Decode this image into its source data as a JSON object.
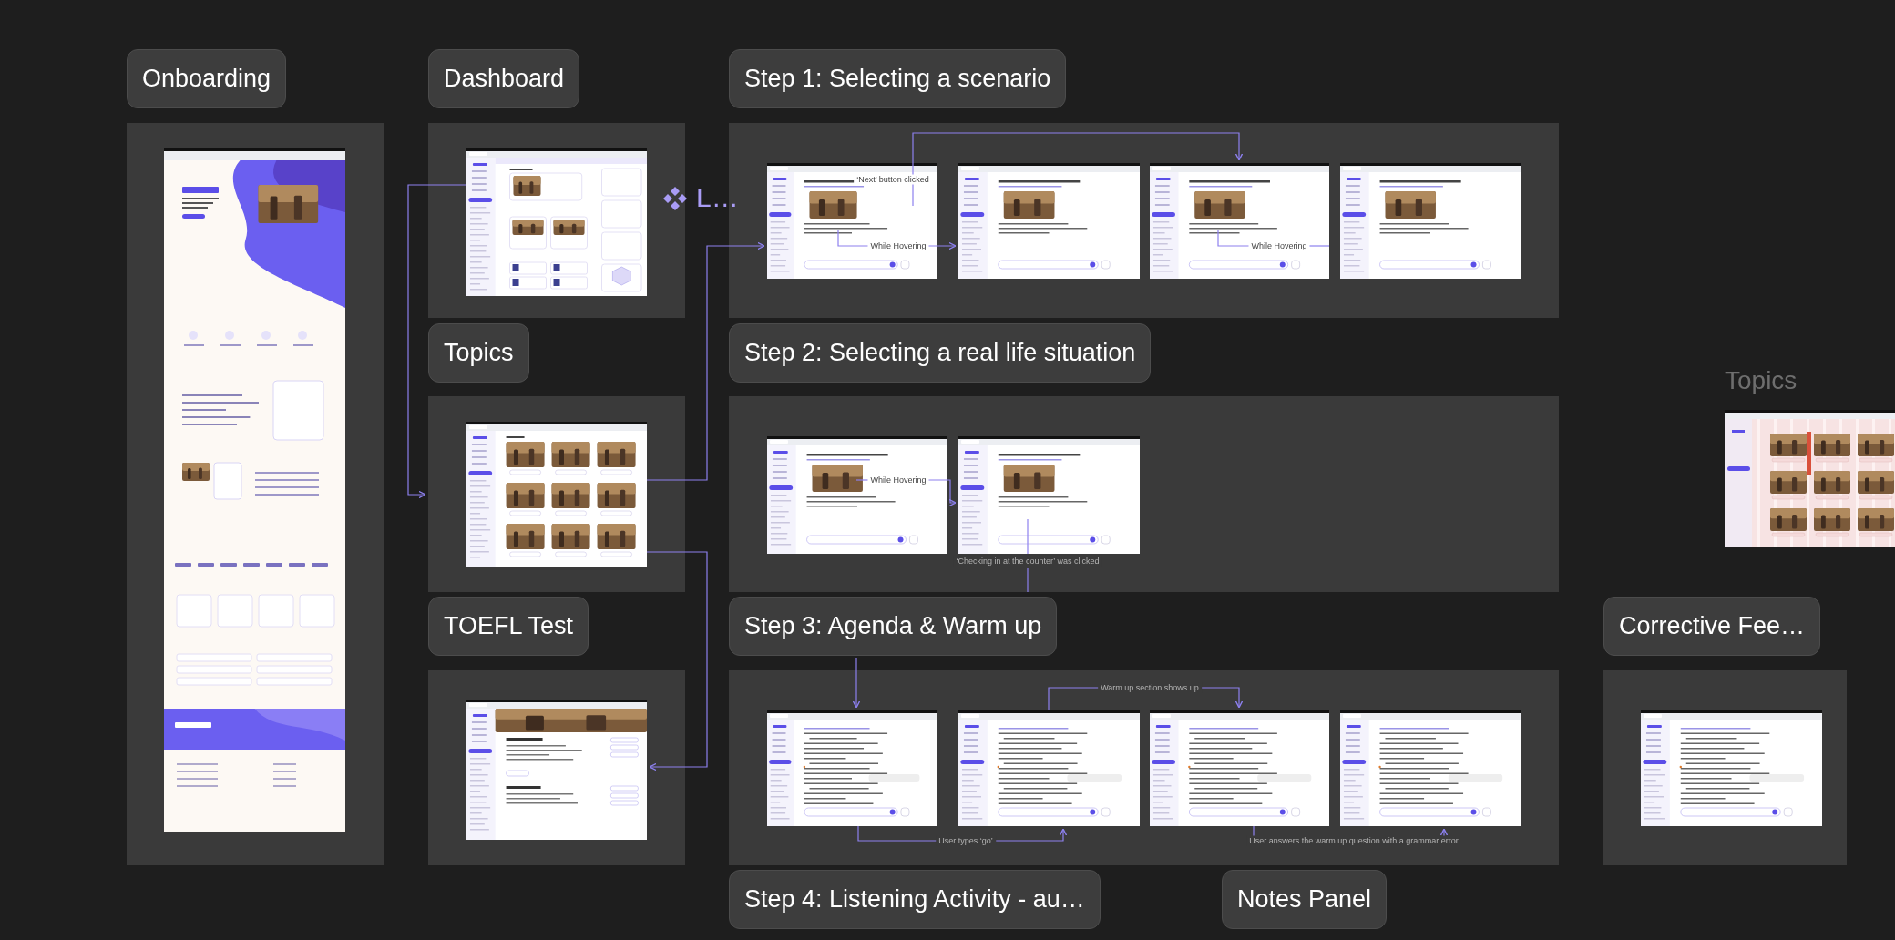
{
  "sections": [
    {
      "label": "Onboarding",
      "screens": [
        {
          "kind": "landing"
        }
      ]
    },
    {
      "label": "Dashboard",
      "screens": [
        {
          "kind": "dashboard"
        }
      ]
    },
    {
      "label": "Topics",
      "screens": [
        {
          "kind": "grid"
        }
      ]
    },
    {
      "label": "TOEFL Test",
      "screens": [
        {
          "kind": "toefl"
        }
      ]
    },
    {
      "label": "Step 1: Selecting a scenario",
      "screens": [
        {
          "kind": "chat-photo"
        },
        {
          "kind": "chat-photo"
        },
        {
          "kind": "chat-photo"
        },
        {
          "kind": "chat-photo"
        }
      ]
    },
    {
      "label": "Step 2: Selecting a real life situation",
      "screens": [
        {
          "kind": "chat-photo"
        },
        {
          "kind": "chat-photo"
        }
      ]
    },
    {
      "label": "Step 3: Agenda & Warm up",
      "screens": [
        {
          "kind": "chat-text"
        },
        {
          "kind": "chat-text"
        },
        {
          "kind": "chat-text"
        },
        {
          "kind": "chat-text"
        }
      ]
    },
    {
      "label": "Corrective Fee…",
      "screens": [
        {
          "kind": "chat-text"
        }
      ]
    },
    {
      "label": "Step 4: Listening Activity - au…"
    },
    {
      "label": "Notes Panel"
    }
  ],
  "component": {
    "label": "L…"
  },
  "faded_frame": {
    "label": "Topics",
    "screen": {
      "kind": "grid-overlay"
    }
  },
  "annotations": [
    {
      "text": "‘Next’ button clicked"
    },
    {
      "text": "While Hovering"
    },
    {
      "text": "While Hovering"
    },
    {
      "text": "While Hovering"
    },
    {
      "text": "‘Checking in at the counter’ was clicked"
    },
    {
      "text": "Warm up section shows up"
    },
    {
      "text": "User types ‘go’"
    },
    {
      "text": "User answers the warm up question with a grammar error"
    }
  ]
}
